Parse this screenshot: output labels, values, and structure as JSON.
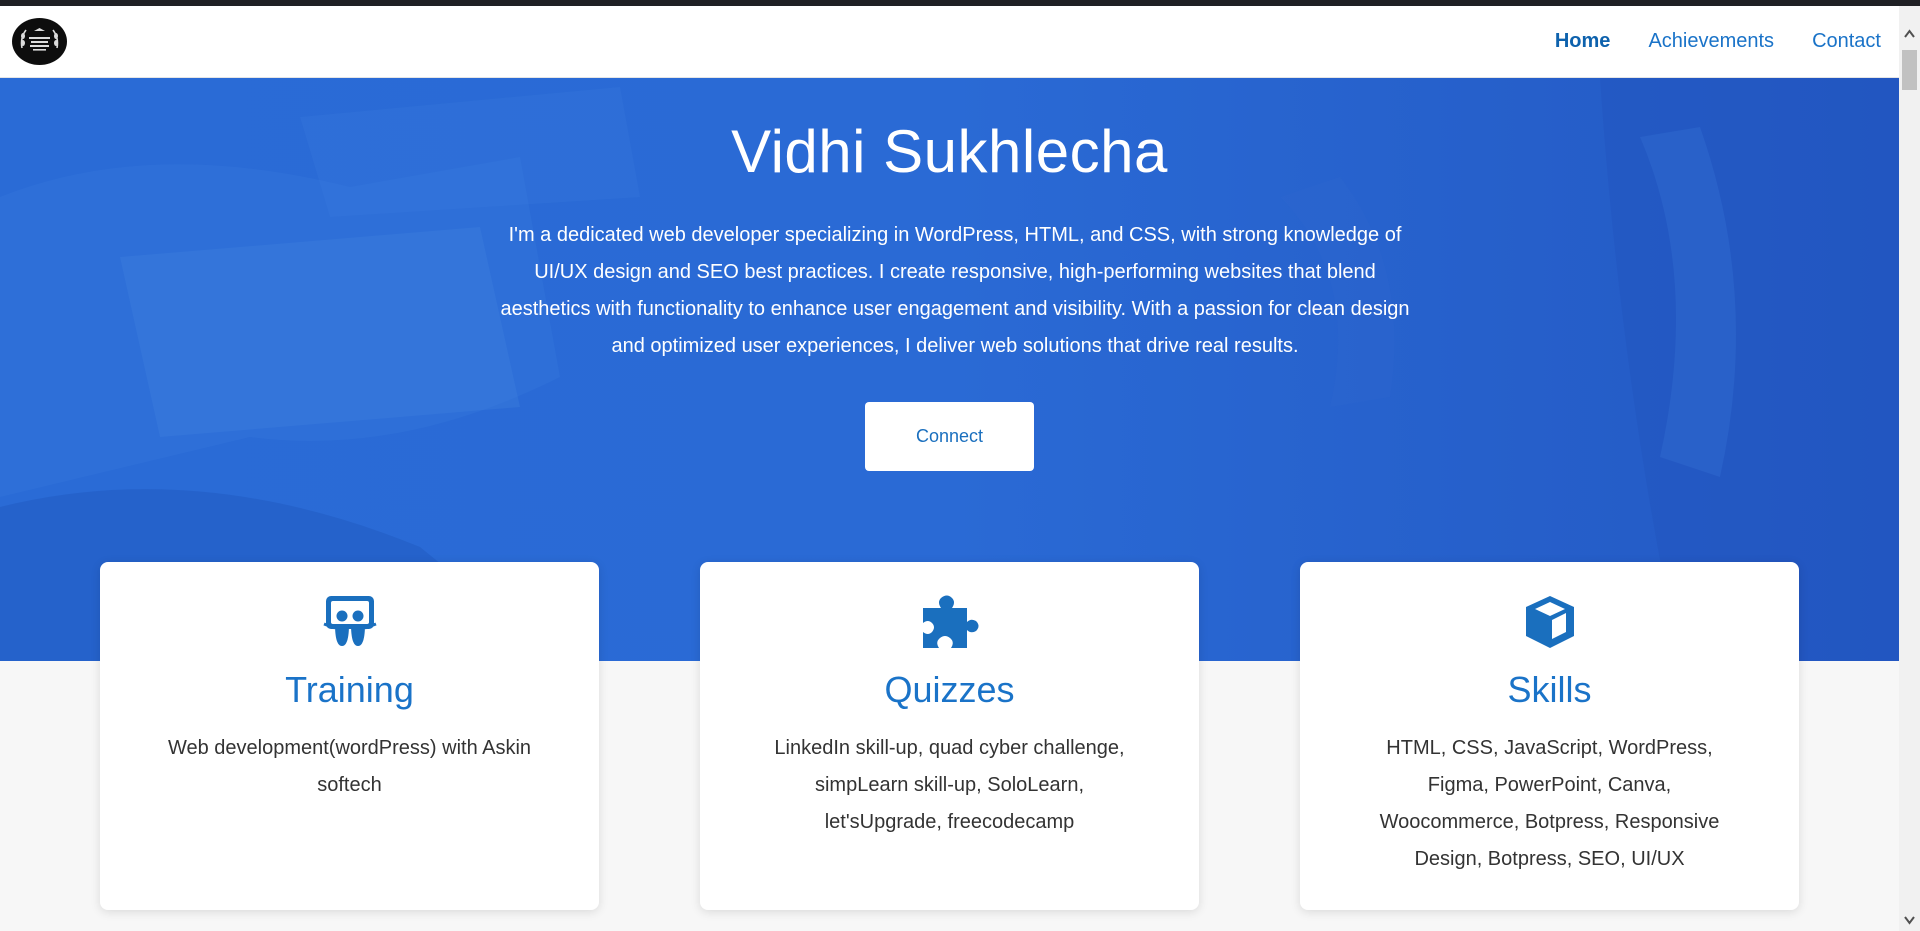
{
  "nav": {
    "logo_alt": "logo",
    "links": [
      {
        "label": "Home",
        "active": true
      },
      {
        "label": "Achievements",
        "active": false
      },
      {
        "label": "Contact",
        "active": false
      }
    ]
  },
  "hero": {
    "title": "Vidhi Sukhlecha",
    "description": "I'm a dedicated web developer specializing in WordPress, HTML, and CSS, with strong knowledge of UI/UX design and SEO best practices. I create responsive, high-performing websites that blend aesthetics with functionality to enhance user engagement and visibility. With a passion for clean design and optimized user experiences, I deliver web solutions that drive real results.",
    "button_label": "Connect"
  },
  "cards": [
    {
      "icon": "slideshare-icon",
      "title": "Training",
      "text": "Web development(wordPress) with Askin softech"
    },
    {
      "icon": "puzzle-icon",
      "title": "Quizzes",
      "text": "LinkedIn skill-up, quad cyber challenge, simpLearn skill-up, SoloLearn, let'sUpgrade, freecodecamp"
    },
    {
      "icon": "cube-icon",
      "title": "Skills",
      "text": "HTML, CSS, JavaScript, WordPress, Figma, PowerPoint, Canva, Woocommerce, Botpress, Responsive Design, Botpress, SEO, UI/UX"
    }
  ],
  "colors": {
    "hero_bg": "#2869d4",
    "accent": "#1a73c8",
    "nav_active": "#0e62ad"
  }
}
